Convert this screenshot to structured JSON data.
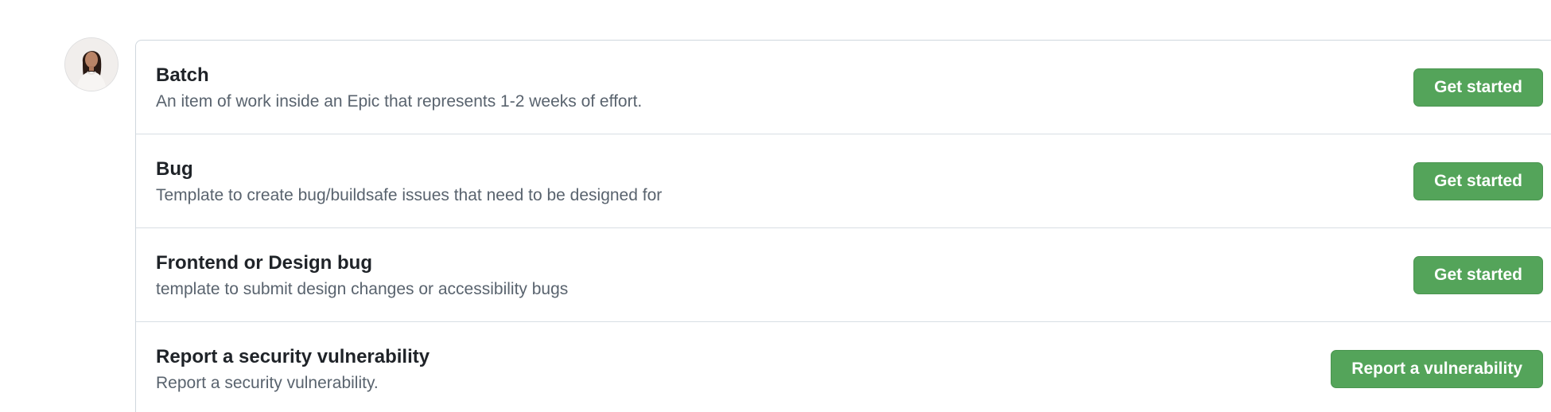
{
  "templates": [
    {
      "title": "Batch",
      "description": "An item of work inside an Epic that represents 1-2 weeks of effort.",
      "button_label": "Get started"
    },
    {
      "title": "Bug",
      "description": "Template to create bug/buildsafe issues that need to be designed for",
      "button_label": "Get started"
    },
    {
      "title": "Frontend or Design bug",
      "description": "template to submit design changes or accessibility bugs",
      "button_label": "Get started"
    },
    {
      "title": "Report a security vulnerability",
      "description": "Report a security vulnerability.",
      "button_label": "Report a vulnerability"
    }
  ],
  "colors": {
    "button_green": "#54a45a",
    "border": "#d0d7de",
    "muted_text": "#59636e"
  }
}
